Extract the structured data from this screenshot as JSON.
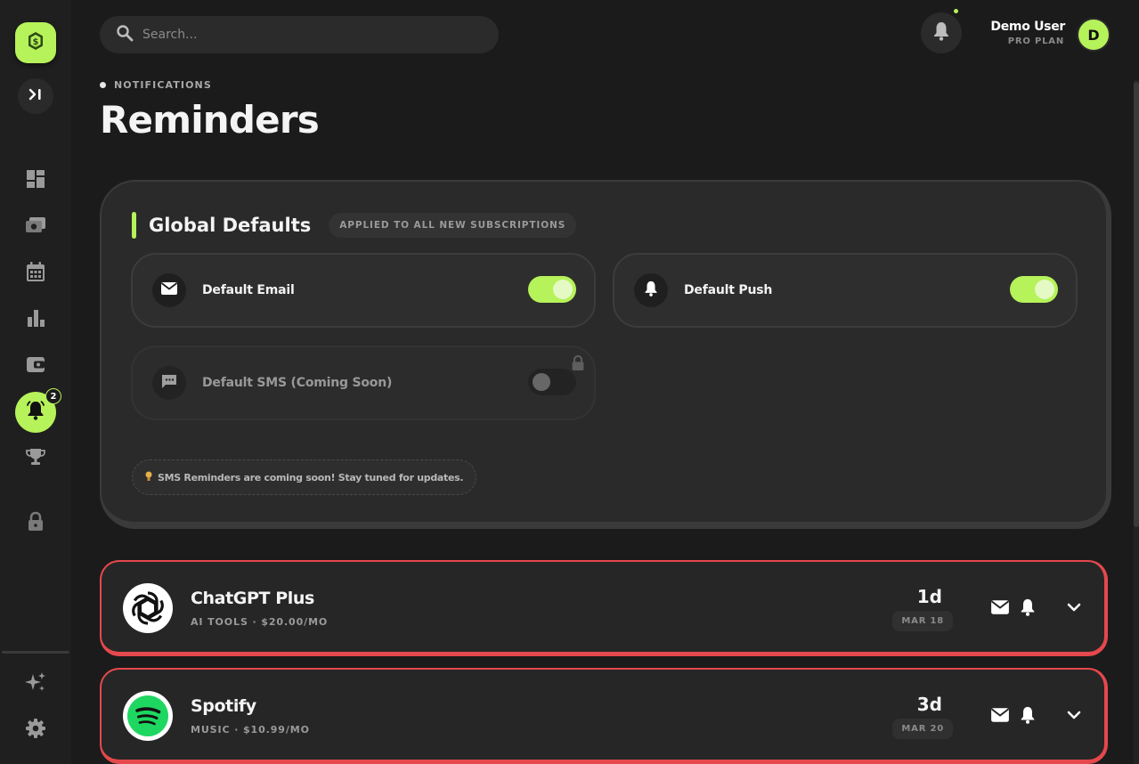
{
  "sidebar": {
    "logo_icon": "dollar-coin-icon",
    "collapse_icon": "expand-sidebar-icon",
    "items": [
      {
        "name": "dashboard",
        "icon": "dashboard-icon"
      },
      {
        "name": "subscriptions",
        "icon": "money-icon"
      },
      {
        "name": "calendar",
        "icon": "calendar-icon"
      },
      {
        "name": "analytics",
        "icon": "bar-chart-icon"
      },
      {
        "name": "wallet",
        "icon": "wallet-icon"
      },
      {
        "name": "reminders",
        "icon": "bell-icon",
        "active": true,
        "badge": "2"
      },
      {
        "name": "achievements",
        "icon": "trophy-icon"
      },
      {
        "name": "locked",
        "icon": "lock-icon"
      }
    ],
    "bottom": [
      {
        "name": "ai",
        "icon": "sparkles-icon"
      },
      {
        "name": "settings",
        "icon": "gear-icon"
      }
    ]
  },
  "topbar": {
    "search_placeholder": "Search...",
    "user_name": "Demo User",
    "user_plan": "PRO PLAN",
    "avatar_initial": "D"
  },
  "header": {
    "eyebrow": "NOTIFICATIONS",
    "title": "Reminders"
  },
  "defaults": {
    "title": "Global Defaults",
    "tag": "APPLIED TO ALL NEW SUBSCRIPTIONS",
    "email": {
      "label": "Default Email",
      "on": true
    },
    "push": {
      "label": "Default Push",
      "on": true
    },
    "sms": {
      "label": "Default SMS (Coming Soon)",
      "on": false,
      "locked": true
    },
    "note": "SMS Reminders are coming soon! Stay tuned for updates."
  },
  "subscriptions": [
    {
      "name": "ChatGPT Plus",
      "meta": "AI TOOLS · $20.00/MO",
      "days": "1d",
      "date": "MAR 18",
      "logo": "openai-icon"
    },
    {
      "name": "Spotify",
      "meta": "MUSIC · $10.99/MO",
      "days": "3d",
      "date": "MAR 20",
      "logo": "spotify-icon"
    }
  ],
  "colors": {
    "accent": "#b6f25a",
    "alert": "#e5484d",
    "background": "#1b1b1b",
    "card": "#2a2a2a",
    "spotify": "#1ed760"
  }
}
